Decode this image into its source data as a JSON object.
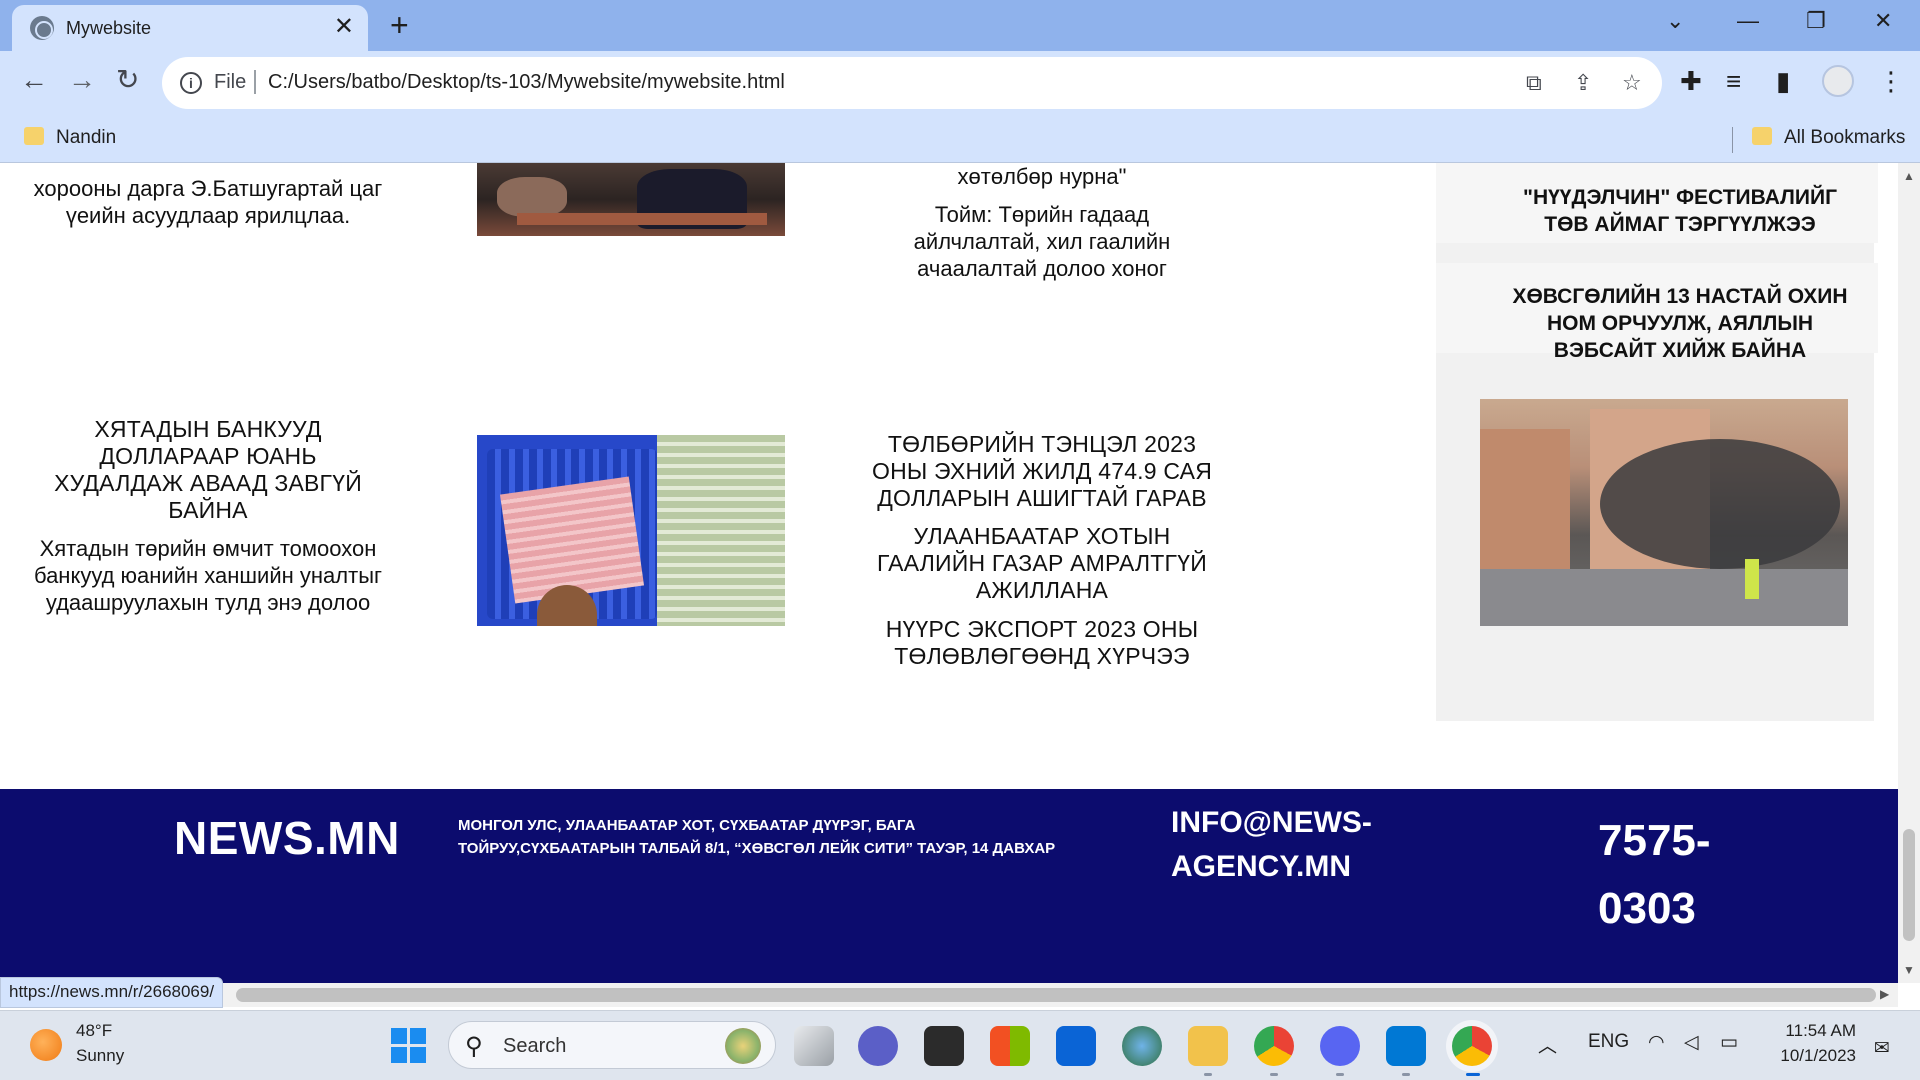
{
  "browser": {
    "tab_title": "Mywebsite",
    "scheme": "File",
    "url": "C:/Users/batbo/Desktop/ts-103/Mywebsite/mywebsite.html",
    "bookmarks": {
      "left": "Nandin",
      "right": "All Bookmarks"
    },
    "status_url": "https://news.mn/r/2668069/"
  },
  "page": {
    "col1_top_snippet": "хорооны дарга Э.Батшугартай цаг үеийн асуудлаар ярилцлаа.",
    "col1_headline": "Хятадын банкууд доллараар юань худалдаж аваад завгүй байна",
    "col1_summary": "Хятадын төрийн өмчит томоохон банкууд юанийн ханшийн уналтыг удаашруулахын тулд энэ долоо",
    "col3_top_quote": "хөтөлбөр нурна\"",
    "col3_top_snippet": "Тойм: Төрийн гадаад айлчлалтай, хил гаалийн ачаалалтай долоо хоног",
    "col3_headlines": [
      "Төлбөрийн тэнцэл 2023 оны эхний жилд 474.9 сая долларын ашигтай гарав",
      "Улаанбаатар хотын гаалийн газар амралтгүй ажиллана",
      "Нүүрс экспорт 2023 оны төлөвлөгөөнд хүрчээ"
    ],
    "sidebar_headlines": [
      "\"Нүүдэлчин\" фестивалийг Төв аймаг тэргүүлжээ",
      "Хөвсгөлийн 13 настай охин ном орчуулж, аяллын вэбсайт хийж байна"
    ]
  },
  "footer": {
    "brand": "NEWS.MN",
    "address": "Монгол Улс, Улаанбаатар хот, Сүхбаатар дүүрэг, Бага тойруу,Сүхбаатарын талбай 8/1, “Хөвсгөл Лейк Сити” тауэр, 14 давхар",
    "email": "info@news-agency.mn",
    "phone": "7575-0303"
  },
  "taskbar": {
    "weather_temp": "48°F",
    "weather_cond": "Sunny",
    "search_label": "Search",
    "lang": "ENG",
    "time": "11:54 AM",
    "date": "10/1/2023"
  }
}
